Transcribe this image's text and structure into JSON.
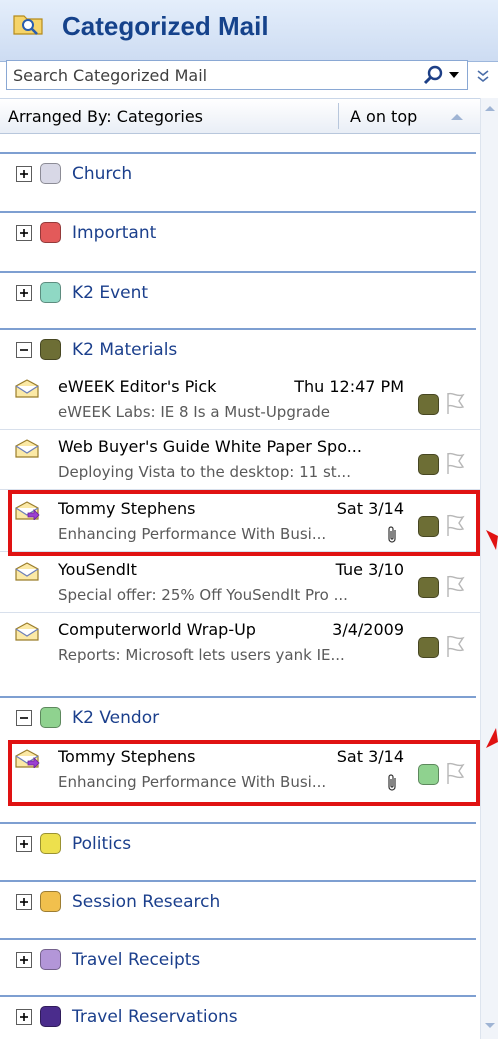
{
  "pane": {
    "title": "Categorized Mail",
    "search_placeholder": "Search Categorized Mail",
    "arranged_by": "Arranged By: Categories",
    "sort_order": "A on top"
  },
  "colors": {
    "accent": "#15428b",
    "highlight": "#e01212",
    "category_line": "#7e9fd1"
  },
  "categories": [
    {
      "label": "Church",
      "color": "#d8d8e6",
      "expanded": false
    },
    {
      "label": "Important",
      "color": "#e35a5a",
      "expanded": false
    },
    {
      "label": "K2 Event",
      "color": "#8fd8c4",
      "expanded": false
    },
    {
      "label": "K2 Materials",
      "color": "#6d6e35",
      "expanded": true
    },
    {
      "label": "K2 Vendor",
      "color": "#8fd28f",
      "expanded": true
    },
    {
      "label": "Politics",
      "color": "#ede04d",
      "expanded": false
    },
    {
      "label": "Session Research",
      "color": "#f1c04d",
      "expanded": false
    },
    {
      "label": "Travel Receipts",
      "color": "#b396d8",
      "expanded": false
    },
    {
      "label": "Travel Reservations",
      "color": "#4a2c8c",
      "expanded": false
    }
  ],
  "mails": {
    "k2_materials": [
      {
        "sender": "eWEEK Editor's Pick",
        "date": "Thu 12:47 PM",
        "preview": "eWEEK Labs: IE 8 Is a Must-Upgrade",
        "attachment": false,
        "icon": "envelope-open-icon"
      },
      {
        "sender": "Web Buyer's Guide White Paper Spo...",
        "date": "",
        "preview": "Deploying Vista to the desktop: 11 st...",
        "attachment": false,
        "icon": "envelope-open-icon"
      },
      {
        "sender": "Tommy Stephens",
        "date": "Sat 3/14",
        "preview": "Enhancing Performance With Busi...",
        "attachment": true,
        "icon": "meeting-request-icon"
      },
      {
        "sender": "YouSendIt",
        "date": "Tue 3/10",
        "preview": "Special offer: 25% Off YouSendIt Pro ...",
        "attachment": false,
        "icon": "envelope-open-icon"
      },
      {
        "sender": "Computerworld Wrap-Up",
        "date": "3/4/2009",
        "preview": "Reports: Microsoft lets users yank IE...",
        "attachment": false,
        "icon": "envelope-open-icon"
      }
    ],
    "k2_vendor": [
      {
        "sender": "Tommy Stephens",
        "date": "Sat 3/14",
        "preview": "Enhancing Performance With Busi...",
        "attachment": true,
        "icon": "meeting-request-icon"
      }
    ]
  }
}
